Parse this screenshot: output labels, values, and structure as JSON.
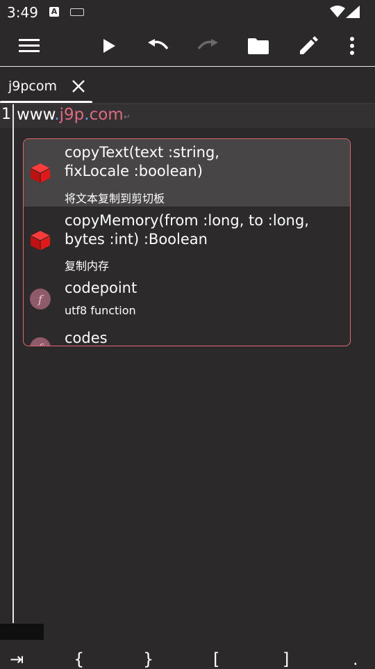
{
  "status_bar": {
    "time": "3:49",
    "a_icon_letter": "A"
  },
  "toolbar": {
    "icons": [
      "menu-icon",
      "play-icon",
      "undo-icon",
      "redo-icon",
      "folder-icon",
      "edit-icon",
      "more-vert-icon"
    ],
    "redo_enabled": false
  },
  "tab": {
    "name": "j9pcom",
    "close_symbol": "✕"
  },
  "editor": {
    "line_number": "1",
    "code": {
      "www": "www",
      "dot1": ".",
      "host": "j9p",
      "dot2": ".",
      "tld": "com",
      "newline_marker": "↵"
    }
  },
  "autocomplete": {
    "items": [
      {
        "title": "copyText(text :string,\nfixLocale :boolean)",
        "desc": "将文本复制到剪切板",
        "icon": "red-cube-icon",
        "selected": true
      },
      {
        "title": "copyMemory(from :long, to :long,\nbytes :int) :Boolean",
        "desc": "复制内存",
        "icon": "red-cube-icon",
        "selected": false
      },
      {
        "title": "codepoint",
        "desc": "utf8 function",
        "icon": "function-icon",
        "icon_letter": "f",
        "selected": false
      },
      {
        "title": "codes",
        "desc": "",
        "icon": "function-icon",
        "icon_letter": "f",
        "selected": false
      }
    ]
  },
  "symbol_bar": {
    "symbols": [
      "⇥",
      "{",
      "}",
      "[",
      "]",
      "."
    ]
  },
  "colors": {
    "background": "#2b2929",
    "popup_border": "#e06a70",
    "host_text": "#e06a82",
    "dot_text": "#6fa4ff",
    "cube": "#d91818"
  }
}
